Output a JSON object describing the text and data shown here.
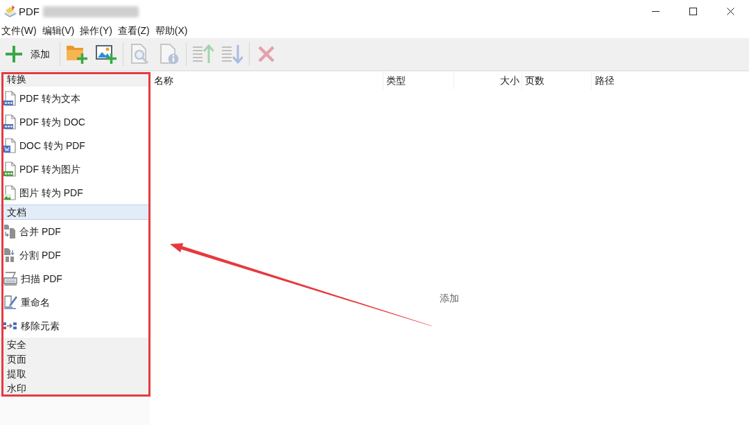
{
  "window": {
    "title": "PDF"
  },
  "menu": [
    "文件(W)",
    "编辑(V)",
    "操作(Y)",
    "查看(Z)",
    "帮助(X)"
  ],
  "toolbar": {
    "groups": [
      {
        "buttons": [
          {
            "label": "添加",
            "disabled": false
          }
        ]
      },
      {
        "buttons": [
          {
            "disabled": false
          },
          {
            "disabled": false
          }
        ]
      },
      {
        "buttons": [
          {
            "disabled": true
          },
          {
            "disabled": true
          }
        ]
      },
      {
        "buttons": [
          {
            "disabled": true
          },
          {
            "disabled": true
          }
        ]
      },
      {
        "buttons": [
          {
            "disabled": true
          }
        ]
      }
    ]
  },
  "sidebar": {
    "groups": [
      {
        "title": "转换",
        "selected": false,
        "items": [
          "PDF 转为文本",
          "PDF 转为 DOC",
          "DOC 转为 PDF",
          "PDF 转为图片",
          "图片 转为 PDF"
        ]
      },
      {
        "title": "文档",
        "selected": true,
        "items": [
          "合并 PDF",
          "分割 PDF",
          "扫描 PDF",
          "重命名",
          "移除元素"
        ]
      },
      {
        "title": "安全",
        "selected": false
      },
      {
        "title": "页面",
        "selected": false
      },
      {
        "title": "提取",
        "selected": false
      },
      {
        "title": "水印",
        "selected": false
      }
    ]
  },
  "file_list": {
    "columns": [
      "名称",
      "类型",
      "大小",
      "页数",
      "路径"
    ],
    "empty_hint": "添加"
  }
}
